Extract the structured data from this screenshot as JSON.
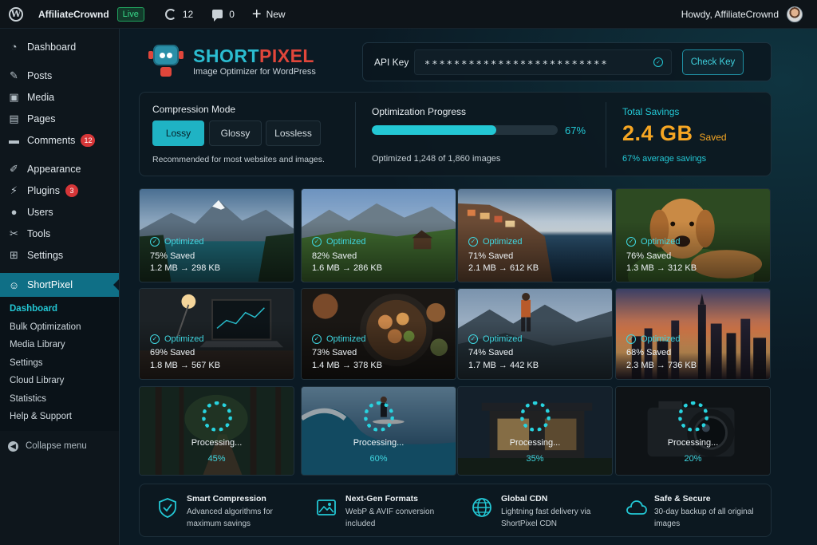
{
  "adminbar": {
    "site_name": "AffiliateCrownd",
    "live_label": "Live",
    "updates_count": "12",
    "comments_count": "0",
    "new_label": "New",
    "howdy": "Howdy, AffiliateCrownd"
  },
  "sidebar": {
    "items": [
      {
        "label": "Dashboard",
        "icon": "dashboard-icon"
      },
      {
        "label": "Posts",
        "icon": "pin-icon"
      },
      {
        "label": "Media",
        "icon": "media-icon"
      },
      {
        "label": "Pages",
        "icon": "pages-icon"
      },
      {
        "label": "Comments",
        "icon": "comments-icon",
        "badge": "12"
      },
      {
        "label": "Appearance",
        "icon": "brush-icon"
      },
      {
        "label": "Plugins",
        "icon": "plugin-icon",
        "badge": "3"
      },
      {
        "label": "Users",
        "icon": "users-icon"
      },
      {
        "label": "Tools",
        "icon": "wrench-icon"
      },
      {
        "label": "Settings",
        "icon": "settings-icon"
      }
    ],
    "active": {
      "label": "ShortPixel",
      "icon": "shortpixel-icon"
    },
    "submenu": [
      "Dashboard",
      "Bulk Optimization",
      "Media Library",
      "Settings",
      "Cloud Library",
      "Statistics",
      "Help & Support"
    ],
    "collapse_label": "Collapse menu"
  },
  "brand": {
    "name_part1": "SHORT",
    "name_part2": "PIXEL",
    "tagline": "Image Optimizer for WordPress"
  },
  "api": {
    "label": "API Key",
    "value": "∗∗∗∗∗∗∗∗∗∗∗∗∗∗∗∗∗∗∗∗∗∗∗∗∗",
    "button": "Check Key"
  },
  "compression": {
    "title": "Compression Mode",
    "modes": [
      "Lossy",
      "Glossy",
      "Lossless"
    ],
    "selected": "Lossy",
    "note": "Recommended for most websites and images."
  },
  "progress": {
    "title": "Optimization Progress",
    "percent": 67,
    "percent_label": "67%",
    "count_text": "Optimized 1,248 of 1,860 images"
  },
  "savings": {
    "title": "Total Savings",
    "value": "2.4 GB",
    "saved_label": "Saved",
    "note": "67% average savings"
  },
  "colors": {
    "accent": "#23c7d4",
    "orange": "#f6a623",
    "badge_red": "#d63638"
  },
  "optimized_label": "Optimized",
  "processing_label": "Processing...",
  "images_optimized": [
    {
      "scene": "mountain-lake",
      "saved": "75% Saved",
      "sizes": "1.2 MB → 298 KB"
    },
    {
      "scene": "alpine-cabin",
      "saved": "82% Saved",
      "sizes": "1.6 MB → 286 KB"
    },
    {
      "scene": "coastal-village",
      "saved": "71% Saved",
      "sizes": "2.1 MB → 612 KB"
    },
    {
      "scene": "golden-retriever",
      "saved": "76% Saved",
      "sizes": "1.3 MB → 312 KB"
    },
    {
      "scene": "laptop-desk",
      "saved": "69% Saved",
      "sizes": "1.8 MB → 567 KB"
    },
    {
      "scene": "food-platter",
      "saved": "73% Saved",
      "sizes": "1.4 MB → 378 KB"
    },
    {
      "scene": "hiker-mountains",
      "saved": "74% Saved",
      "sizes": "1.7 MB → 442 KB"
    },
    {
      "scene": "city-sunset",
      "saved": "68% Saved",
      "sizes": "2.3 MB → 736 KB"
    }
  ],
  "images_processing": [
    {
      "scene": "forest-path",
      "percent": "45%"
    },
    {
      "scene": "surfer-wave",
      "percent": "60%"
    },
    {
      "scene": "modern-house",
      "percent": "35%"
    },
    {
      "scene": "camera",
      "percent": "20%"
    }
  ],
  "features": [
    {
      "icon": "shield-check-icon",
      "title": "Smart Compression",
      "desc": "Advanced algorithms for maximum savings"
    },
    {
      "icon": "image-icon",
      "title": "Next-Gen Formats",
      "desc": "WebP & AVIF conversion included"
    },
    {
      "icon": "globe-icon",
      "title": "Global CDN",
      "desc": "Lightning fast delivery via ShortPixel CDN"
    },
    {
      "icon": "cloud-icon",
      "title": "Safe & Secure",
      "desc": "30-day backup of all original images"
    }
  ]
}
